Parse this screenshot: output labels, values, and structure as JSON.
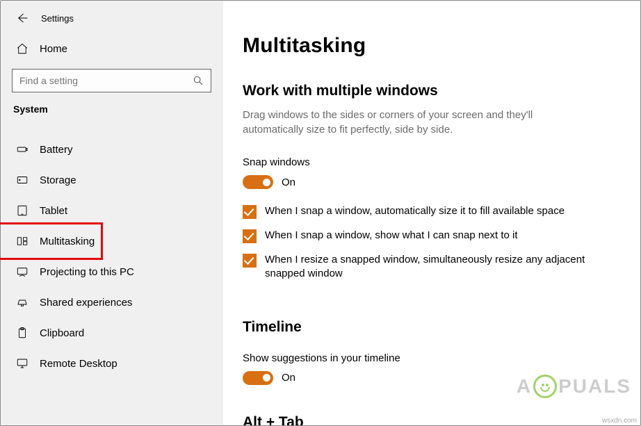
{
  "header": {
    "title": "Settings"
  },
  "sidebar": {
    "home_label": "Home",
    "search_placeholder": "Find a setting",
    "category_label": "System",
    "items": [
      {
        "id": "battery",
        "label": "Battery"
      },
      {
        "id": "storage",
        "label": "Storage"
      },
      {
        "id": "tablet",
        "label": "Tablet"
      },
      {
        "id": "multitasking",
        "label": "Multitasking",
        "active": true,
        "highlighted": true
      },
      {
        "id": "projecting",
        "label": "Projecting to this PC"
      },
      {
        "id": "shared",
        "label": "Shared experiences"
      },
      {
        "id": "clipboard",
        "label": "Clipboard"
      },
      {
        "id": "remote",
        "label": "Remote Desktop"
      }
    ]
  },
  "main": {
    "page_title": "Multitasking",
    "sections": {
      "windows": {
        "title": "Work with multiple windows",
        "desc": "Drag windows to the sides or corners of your screen and they'll automatically size to fit perfectly, side by side.",
        "snap_label": "Snap windows",
        "snap_toggle_state": "On",
        "checks": [
          "When I snap a window, automatically size it to fill available space",
          "When I snap a window, show what I can snap next to it",
          "When I resize a snapped window, simultaneously resize any adjacent snapped window"
        ]
      },
      "timeline": {
        "title": "Timeline",
        "suggest_label": "Show suggestions in your timeline",
        "suggest_toggle_state": "On"
      },
      "alttab": {
        "title": "Alt + Tab"
      }
    }
  },
  "watermark": {
    "pre": "A",
    "post": "PUALS",
    "url": "wsxdn.com"
  },
  "colors": {
    "accent": "#d86f12",
    "highlight": "#e30808"
  }
}
